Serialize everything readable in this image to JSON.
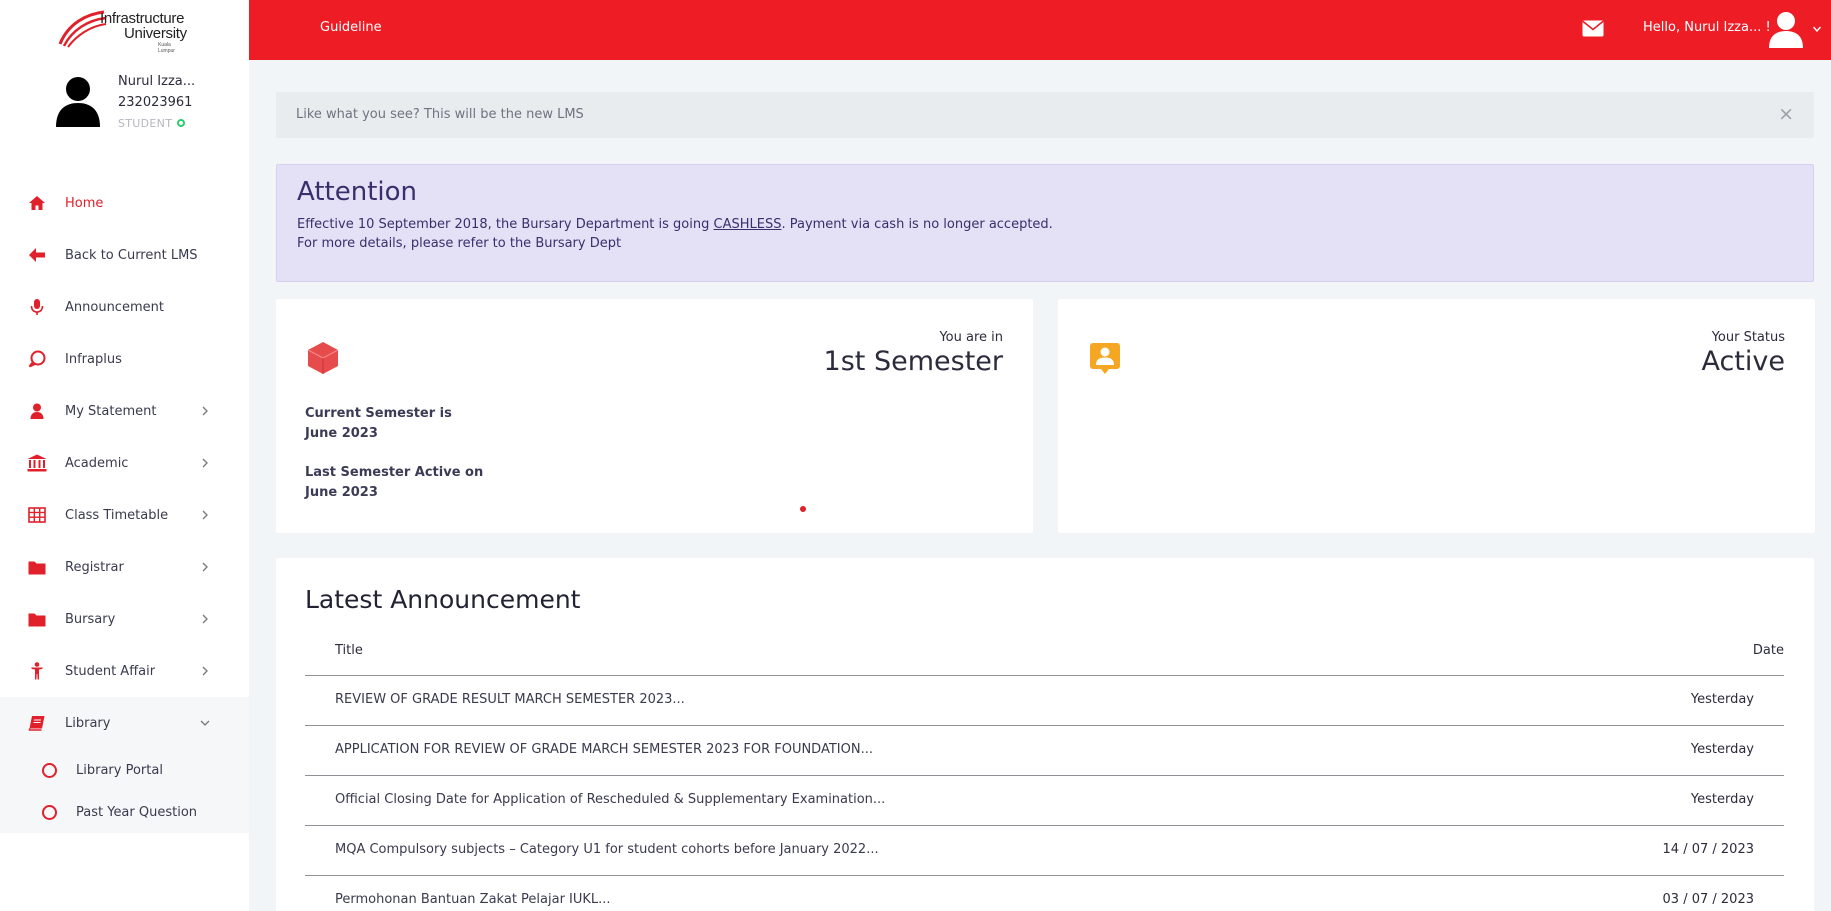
{
  "brand": {
    "line1": "Infrastructure",
    "line2": "University",
    "line3": "Kuala Lumpur",
    "accent": "#ee1c25"
  },
  "profile": {
    "name": "Nurul Izza...",
    "id": "232023961",
    "role": "STUDENT"
  },
  "sidebar": {
    "items": [
      {
        "label": "Home",
        "icon": "home-icon",
        "active": true
      },
      {
        "label": "Back to Current LMS",
        "icon": "arrow-left-icon"
      },
      {
        "label": "Announcement",
        "icon": "microphone-icon"
      },
      {
        "label": "Infraplus",
        "icon": "chat-bubble-icon"
      },
      {
        "label": "My Statement",
        "icon": "user-icon",
        "expandable": true
      },
      {
        "label": "Academic",
        "icon": "bank-icon",
        "expandable": true
      },
      {
        "label": "Class Timetable",
        "icon": "table-icon",
        "expandable": true
      },
      {
        "label": "Registrar",
        "icon": "folder-icon",
        "expandable": true
      },
      {
        "label": "Bursary",
        "icon": "folder-icon",
        "expandable": true
      },
      {
        "label": "Student Affair",
        "icon": "person-icon",
        "expandable": true
      },
      {
        "label": "Library",
        "icon": "book-icon",
        "expandable": true,
        "open": true
      }
    ],
    "library_sub": [
      {
        "label": "Library Portal"
      },
      {
        "label": "Past Year Question"
      }
    ]
  },
  "topbar": {
    "guideline": "Guideline",
    "greeting": "Hello, Nurul Izza... !"
  },
  "notice": {
    "text": "Like what you see? This will be the new LMS",
    "close": "×"
  },
  "attention": {
    "title": "Attention",
    "line1_pre": "Effective 10 September 2018, the Bursary Department is going ",
    "line1_link": "CASHLESS",
    "line1_post": ". Payment via cash is no longer accepted.",
    "line2": "For more details, please refer to the Bursary Dept"
  },
  "semester_card": {
    "caption": "You are in",
    "value": "1st Semester",
    "current_label": "Current Semester is",
    "current_value": "June 2023",
    "last_label": "Last Semester Active on",
    "last_value": "June 2023"
  },
  "status_card": {
    "caption": "Your Status",
    "value": "Active"
  },
  "announcements": {
    "title": "Latest Announcement",
    "col_title": "Title",
    "col_date": "Date",
    "rows": [
      {
        "title": "REVIEW OF GRADE RESULT MARCH SEMESTER 2023...",
        "date": "Yesterday"
      },
      {
        "title": "APPLICATION FOR REVIEW OF GRADE MARCH SEMESTER 2023 FOR FOUNDATION...",
        "date": "Yesterday"
      },
      {
        "title": "Official Closing Date for Application of Rescheduled & Supplementary Examination...",
        "date": "Yesterday"
      },
      {
        "title": "MQA Compulsory subjects – Category U1 for student cohorts before January 2022...",
        "date": "14 / 07 / 2023"
      },
      {
        "title": "Permohonan Bantuan Zakat Pelajar IUKL...",
        "date": "03 / 07 / 2023"
      }
    ]
  }
}
